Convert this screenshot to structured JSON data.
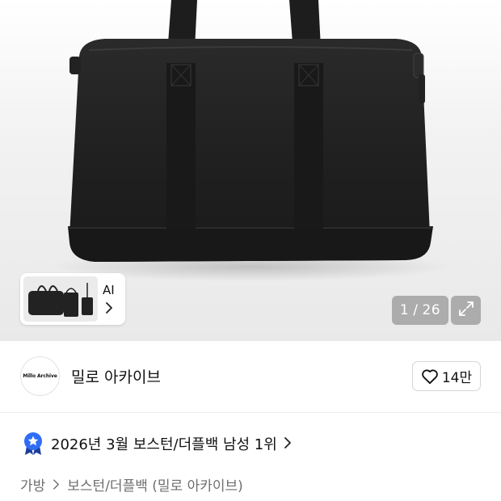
{
  "gallery": {
    "current_page": "1",
    "total_pages": "26",
    "page_separator": "/",
    "thumbnail_badge": "AI"
  },
  "seller": {
    "logo_text": "Millo Archive",
    "name": "밀로 아카이브",
    "likes": "14만"
  },
  "ranking": {
    "text": "2026년 3월 보스턴/더플백 남성 1위",
    "badge_color": "#2f6df6"
  },
  "breadcrumb": {
    "items": [
      "가방",
      "보스턴/더플백 (밀로 아카이브)"
    ]
  },
  "icons": {
    "expand": "expand-icon",
    "heart": "heart-outline-icon",
    "chevron": "chevron-right-icon",
    "rank_badge": "star-ribbon-icon"
  }
}
